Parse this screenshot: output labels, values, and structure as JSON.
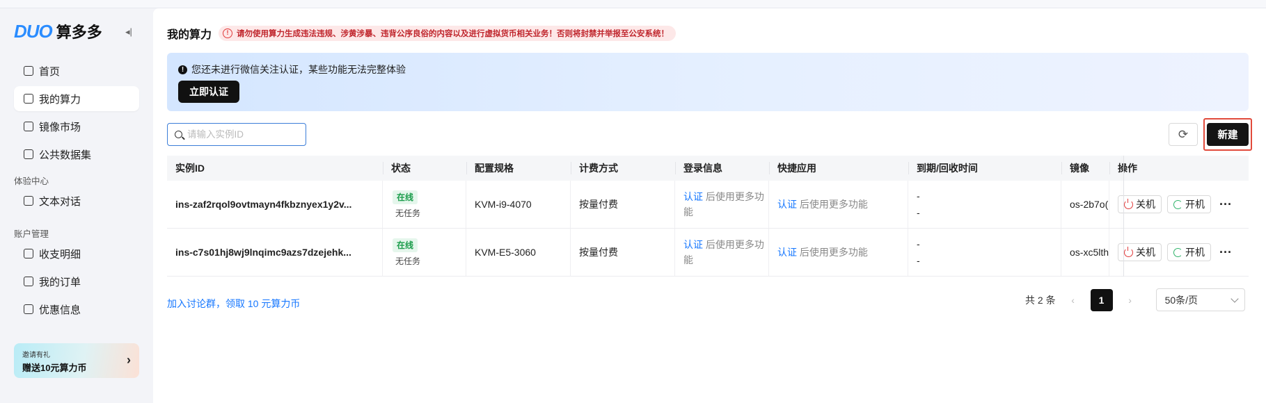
{
  "brand": {
    "logo_mark": "DUO",
    "logo_text": "算多多",
    "accent": "#2a8cff"
  },
  "sidebar": {
    "collapse_glyph": "◂|",
    "items": [
      {
        "label": "首页",
        "icon": "home-icon"
      },
      {
        "label": "我的算力",
        "icon": "compute-icon",
        "active": true
      },
      {
        "label": "镜像市场",
        "icon": "mirror-icon"
      },
      {
        "label": "公共数据集",
        "icon": "dataset-icon"
      }
    ],
    "group_experience": "体验中心",
    "experience_items": [
      {
        "label": "文本对话",
        "icon": "chat-icon"
      }
    ],
    "group_account": "账户管理",
    "account_items": [
      {
        "label": "收支明细",
        "icon": "ledger-icon"
      },
      {
        "label": "我的订单",
        "icon": "order-icon"
      },
      {
        "label": "优惠信息",
        "icon": "coupon-icon"
      }
    ],
    "invite": {
      "small": "邀请有礼",
      "big": "赠送10元算力币",
      "arrow": "›"
    }
  },
  "header": {
    "title": "我的算力",
    "warning": "请勿使用算力生成违法违规、涉黄涉暴、违背公序良俗的内容以及进行虚拟货币相关业务！否则将封禁并举报至公安系统！",
    "warning_glyph": "!"
  },
  "notice": {
    "text": "您还未进行微信关注认证，某些功能无法完整体验",
    "glyph": "!",
    "button": "立即认证"
  },
  "toolbar": {
    "search_placeholder": "请输入实例ID",
    "refresh_glyph": "⟳",
    "new_label": "新建"
  },
  "table": {
    "columns": [
      "实例ID",
      "状态",
      "配置规格",
      "计费方式",
      "登录信息",
      "快捷应用",
      "到期/回收时间",
      "镜像",
      "操作"
    ],
    "rows": [
      {
        "id": "ins-zaf2rqol9ovtmayn4fkbznyex1y2v...",
        "status": "在线",
        "task": "无任务",
        "spec": "KVM-i9-4070",
        "billing": "按量付费",
        "login_link": "认证",
        "login_rest": " 后使用更多功能",
        "app_link": "认证",
        "app_rest": " 后使用更多功能",
        "expire": "-",
        "recycle": "-",
        "mirror": "os-2b7o(",
        "shutdown": "关机",
        "startup": "开机",
        "more": "···"
      },
      {
        "id": "ins-c7s01hj8wj9lnqimc9azs7dzejehk...",
        "status": "在线",
        "task": "无任务",
        "spec": "KVM-E5-3060",
        "billing": "按量付费",
        "login_link": "认证",
        "login_rest": " 后使用更多功能",
        "app_link": "认证",
        "app_rest": " 后使用更多功能",
        "expire": "-",
        "recycle": "-",
        "mirror": "os-xc5lth",
        "shutdown": "关机",
        "startup": "开机",
        "more": "···"
      }
    ]
  },
  "footer": {
    "promo_link": "加入讨论群，领取 10 元算力币",
    "total": "共 2 条",
    "prev": "‹",
    "current_page": "1",
    "next": "›",
    "page_size": "50条/页"
  }
}
